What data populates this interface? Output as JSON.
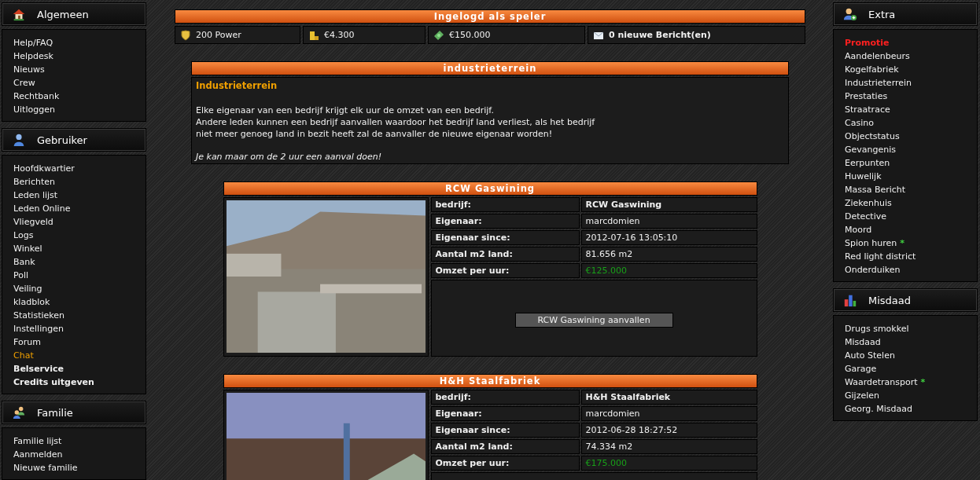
{
  "left_sidebar": [
    {
      "title": "Algemeen",
      "items": [
        {
          "label": "Help/FAQ",
          "kind": "normal"
        },
        {
          "label": "Helpdesk",
          "kind": "normal"
        },
        {
          "label": "Nieuws",
          "kind": "normal"
        },
        {
          "label": "Crew",
          "kind": "normal"
        },
        {
          "label": "Rechtbank",
          "kind": "normal"
        },
        {
          "label": "Uitloggen",
          "kind": "normal"
        }
      ]
    },
    {
      "title": "Gebruiker",
      "items": [
        {
          "label": "Hoofdkwartier",
          "kind": "normal"
        },
        {
          "label": "Berichten",
          "kind": "normal"
        },
        {
          "label": "Leden lijst",
          "kind": "normal"
        },
        {
          "label": "Leden Online",
          "kind": "normal"
        },
        {
          "label": "Vliegveld",
          "kind": "normal"
        },
        {
          "label": "Logs",
          "kind": "normal"
        },
        {
          "label": "Winkel",
          "kind": "normal"
        },
        {
          "label": "Bank",
          "kind": "normal"
        },
        {
          "label": "Poll",
          "kind": "normal"
        },
        {
          "label": "Veiling",
          "kind": "normal"
        },
        {
          "label": "kladblok",
          "kind": "normal"
        },
        {
          "label": "Statistieken",
          "kind": "normal"
        },
        {
          "label": "Instellingen",
          "kind": "normal"
        },
        {
          "label": "Forum",
          "kind": "normal"
        },
        {
          "label": "Chat",
          "kind": "highlight"
        },
        {
          "label": "Belservice",
          "kind": "bold"
        },
        {
          "label": "Credits uitgeven",
          "kind": "bold"
        }
      ]
    },
    {
      "title": "Familie",
      "items": [
        {
          "label": "Familie lijst",
          "kind": "normal"
        },
        {
          "label": "Aanmelden",
          "kind": "normal"
        },
        {
          "label": "Nieuwe familie",
          "kind": "normal"
        }
      ]
    }
  ],
  "header": {
    "title": "Ingelogd als speler",
    "stats": [
      {
        "text": "200 Power",
        "bold": false
      },
      {
        "text": "€4.300",
        "bold": false
      },
      {
        "text": "€150.000",
        "bold": false
      },
      {
        "text": "0 nieuwe Bericht(en)",
        "bold": true
      }
    ]
  },
  "info_panel": {
    "title": "industrieterrein",
    "heading": "Industrieterrein",
    "paragraphs": [
      "Elke eigenaar van een bedrijf krijgt elk uur de omzet van een bedrijf.",
      "Andere leden kunnen een bedrijf aanvallen waardoor het bedrijf land verliest, als het bedrijf",
      "niet meer genoeg land in bezit heeft zal de aanvaller de nieuwe eigenaar worden!"
    ],
    "note": "Je kan maar om de 2 uur een aanval doen!"
  },
  "companies": [
    {
      "title": "RCW Gaswining",
      "rows": [
        {
          "label": "bedrijf:",
          "value": "RCW Gaswining",
          "kind": "name"
        },
        {
          "label": "Eigenaar:",
          "value": "marcdomien",
          "kind": "plain"
        },
        {
          "label": "Eigenaar since:",
          "value": "2012-07-16 13:05:10",
          "kind": "plain"
        },
        {
          "label": "Aantal m2 land:",
          "value": "81.656 m2",
          "kind": "plain"
        },
        {
          "label": "Omzet per uur:",
          "value": "€125.000",
          "kind": "money"
        }
      ],
      "button": "RCW Gaswining aanvallen"
    },
    {
      "title": "H&H Staalfabriek",
      "rows": [
        {
          "label": "bedrijf:",
          "value": "H&H Staalfabriek",
          "kind": "name"
        },
        {
          "label": "Eigenaar:",
          "value": "marcdomien",
          "kind": "plain"
        },
        {
          "label": "Eigenaar since:",
          "value": "2012-06-28 18:27:52",
          "kind": "plain"
        },
        {
          "label": "Aantal m2 land:",
          "value": "74.334 m2",
          "kind": "plain"
        },
        {
          "label": "Omzet per uur:",
          "value": "€175.000",
          "kind": "money"
        }
      ]
    }
  ],
  "right_sidebar": [
    {
      "title": "Extra",
      "items": [
        {
          "label": "Promotie",
          "kind": "promo"
        },
        {
          "label": "Aandelenbeurs",
          "kind": "normal"
        },
        {
          "label": "Kogelfabriek",
          "kind": "normal"
        },
        {
          "label": "Industrieterrein",
          "kind": "normal"
        },
        {
          "label": "Prestaties",
          "kind": "normal"
        },
        {
          "label": "Straatrace",
          "kind": "normal"
        },
        {
          "label": "Casino",
          "kind": "normal"
        },
        {
          "label": "Objectstatus",
          "kind": "normal"
        },
        {
          "label": "Gevangenis",
          "kind": "normal"
        },
        {
          "label": "Eerpunten",
          "kind": "normal"
        },
        {
          "label": "Huwelijk",
          "kind": "normal"
        },
        {
          "label": "Massa Bericht",
          "kind": "normal"
        },
        {
          "label": "Ziekenhuis",
          "kind": "normal"
        },
        {
          "label": "Detective",
          "kind": "normal"
        },
        {
          "label": "Moord",
          "kind": "normal"
        },
        {
          "label": "Spion huren",
          "kind": "normal",
          "marker": "*"
        },
        {
          "label": "Red light district",
          "kind": "normal"
        },
        {
          "label": "Onderduiken",
          "kind": "normal"
        }
      ]
    },
    {
      "title": "Misdaad",
      "items": [
        {
          "label": "Drugs smokkel",
          "kind": "normal"
        },
        {
          "label": "Misdaad",
          "kind": "normal"
        },
        {
          "label": "Auto Stelen",
          "kind": "normal"
        },
        {
          "label": "Garage",
          "kind": "normal"
        },
        {
          "label": "Waardetransport",
          "kind": "normal",
          "marker": "*"
        },
        {
          "label": "Gijzelen",
          "kind": "normal"
        },
        {
          "label": "Georg. Misdaad",
          "kind": "normal"
        }
      ]
    }
  ]
}
